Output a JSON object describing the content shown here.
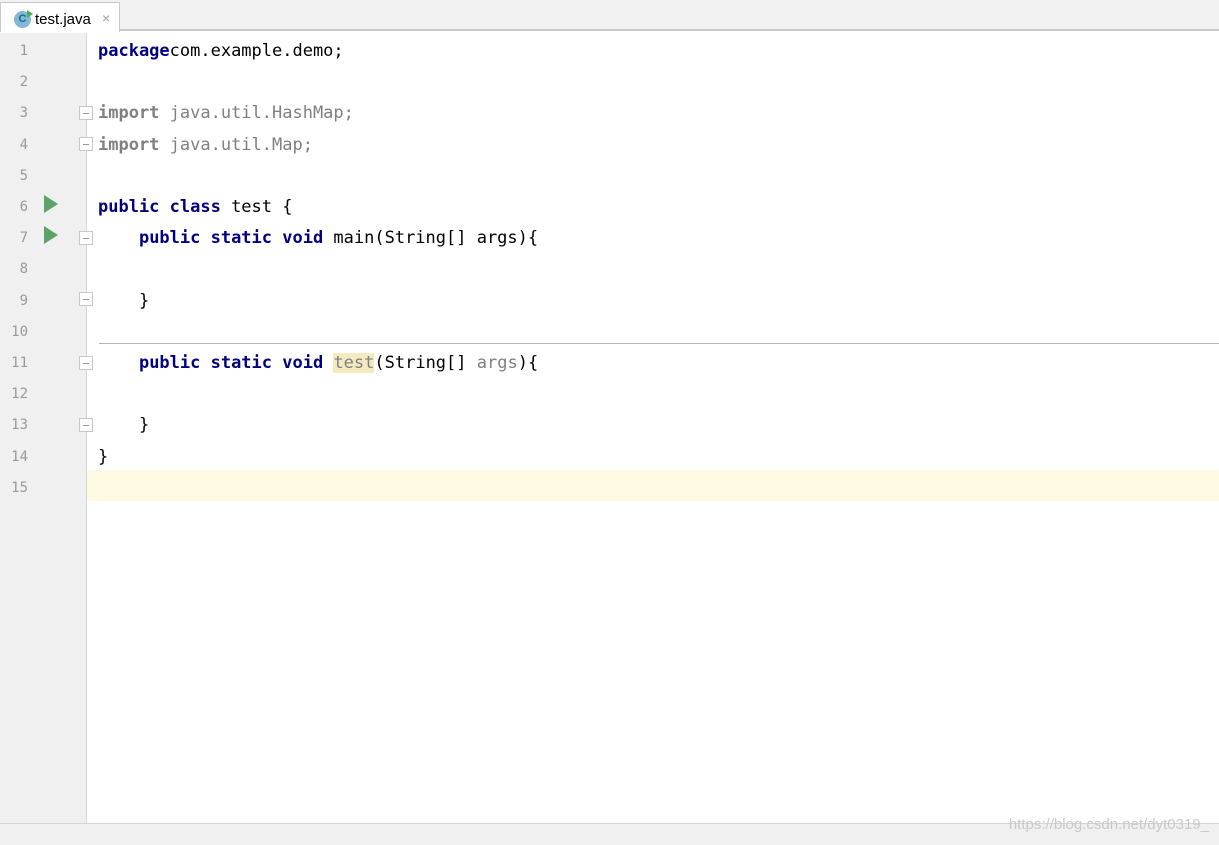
{
  "tab": {
    "label": "test.java",
    "icon": "class-file-icon",
    "close": "×"
  },
  "lines": [
    {
      "n": "1",
      "segs": [
        [
          "kw",
          "package"
        ],
        [
          "",
          "com.example.demo;"
        ]
      ]
    },
    {
      "n": "2",
      "segs": []
    },
    {
      "n": "3",
      "segs": [
        [
          "kw dim",
          "import"
        ],
        [
          "dim",
          " java.util.HashMap;"
        ]
      ]
    },
    {
      "n": "4",
      "segs": [
        [
          "kw dim",
          "import"
        ],
        [
          "dim",
          " java.util.Map;"
        ]
      ]
    },
    {
      "n": "5",
      "segs": []
    },
    {
      "n": "6",
      "segs": [
        [
          "kw",
          "public class"
        ],
        [
          "",
          " test {"
        ]
      ]
    },
    {
      "n": "7",
      "segs": [
        [
          "",
          "    "
        ],
        [
          "kw",
          "public static void"
        ],
        [
          "",
          " main(String[] args){"
        ]
      ]
    },
    {
      "n": "8",
      "segs": []
    },
    {
      "n": "9",
      "segs": [
        [
          "",
          "    }"
        ]
      ]
    },
    {
      "n": "10",
      "segs": []
    },
    {
      "n": "11",
      "segs": [
        [
          "",
          "    "
        ],
        [
          "kw",
          "public static void"
        ],
        [
          "",
          " "
        ],
        [
          "dim hl",
          "test"
        ],
        [
          "",
          "(String[] "
        ],
        [
          "dim",
          "args"
        ],
        [
          "",
          "){"
        ]
      ]
    },
    {
      "n": "12",
      "segs": []
    },
    {
      "n": "13",
      "segs": [
        [
          "",
          "    }"
        ]
      ]
    },
    {
      "n": "14",
      "segs": [
        [
          "",
          "}"
        ]
      ]
    },
    {
      "n": "15",
      "segs": []
    }
  ],
  "watermark": "https://blog.csdn.net/dyt0319_",
  "colors": {
    "keyword": "#000080",
    "dim": "#808080",
    "run": "#5aa469",
    "current_line": "#fffae3"
  }
}
